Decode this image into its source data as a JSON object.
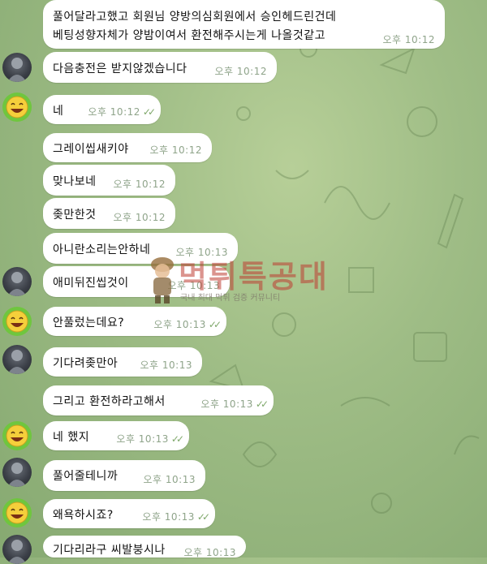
{
  "colors": {
    "bubble": "#ffffff",
    "time": "#8fa48a",
    "read_check": "#7fa86b",
    "background": "#a4c28b"
  },
  "messages": [
    {
      "lines": [
        "풀어달라고했고 회원님 양방의심회원에서 승인헤드린건데",
        "베팅성향자체가 양밤이여서 환전해주시는게 나올것같고"
      ],
      "time": "오후 10:12",
      "read": false,
      "avatar": "none"
    },
    {
      "lines": [
        "다음충전은 받지않겠습니다"
      ],
      "time": "오후 10:12",
      "read": false,
      "avatar": "photo"
    },
    {
      "lines": [
        "네"
      ],
      "time": "오후 10:12",
      "read": true,
      "avatar": "smile"
    },
    {
      "lines": [
        "그레이씹새키야"
      ],
      "time": "오후 10:12",
      "read": false,
      "avatar": "none"
    },
    {
      "lines": [
        "맞나보네"
      ],
      "time": "오후 10:12",
      "read": false,
      "avatar": "none"
    },
    {
      "lines": [
        "좆만한것"
      ],
      "time": "오후 10:12",
      "read": false,
      "avatar": "none"
    },
    {
      "lines": [
        "아니란소리는안하네"
      ],
      "time": "오후 10:13",
      "read": false,
      "avatar": "none"
    },
    {
      "lines": [
        "애미뒤진씹것이"
      ],
      "time": "오후 10:13",
      "read": false,
      "avatar": "photo"
    },
    {
      "lines": [
        "안풀렀는데요?"
      ],
      "time": "오후 10:13",
      "read": true,
      "avatar": "smile"
    },
    {
      "lines": [
        "기다려좆만아"
      ],
      "time": "오후 10:13",
      "read": false,
      "avatar": "photo"
    },
    {
      "lines": [
        "그리고 환전하라고해서"
      ],
      "time": "오후 10:13",
      "read": true,
      "avatar": "none"
    },
    {
      "lines": [
        "네 했지"
      ],
      "time": "오후 10:13",
      "read": true,
      "avatar": "smile"
    },
    {
      "lines": [
        "풀어줄테니까"
      ],
      "time": "오후 10:13",
      "read": false,
      "avatar": "photo"
    },
    {
      "lines": [
        "왜욕하시죠?"
      ],
      "time": "오후 10:13",
      "read": true,
      "avatar": "smile"
    },
    {
      "lines": [
        "기다리라구 씨발붕시나"
      ],
      "time": "오후 10:13",
      "read": false,
      "avatar": "photo"
    }
  ],
  "watermark": {
    "title": "먹튀특공대",
    "subtitle": "국내 최대 먹튀 검증 커뮤니티"
  }
}
